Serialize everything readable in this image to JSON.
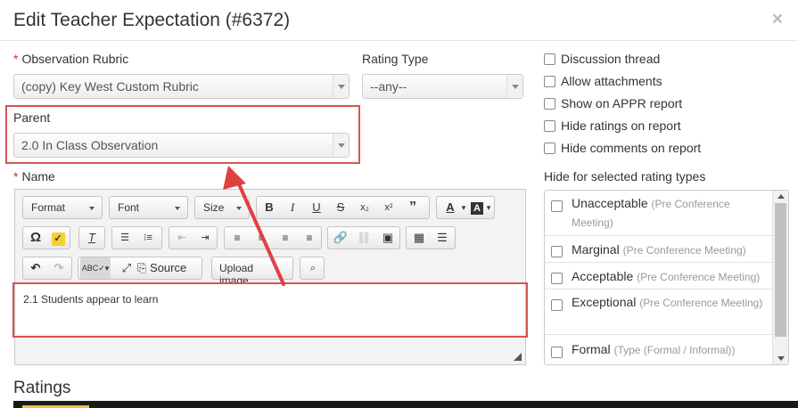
{
  "modal": {
    "title": "Edit Teacher Expectation (#6372)",
    "close_glyph": "×"
  },
  "form": {
    "required_marker": "*",
    "observation_rubric": {
      "label": "Observation Rubric",
      "value": "(copy) Key West Custom Rubric"
    },
    "rating_type": {
      "label": "Rating Type",
      "value": "--any--"
    },
    "parent": {
      "label": "Parent",
      "value": "2.0 In Class Observation"
    },
    "name": {
      "label": "Name"
    }
  },
  "editor": {
    "format_label": "Format",
    "font_label": "Font",
    "size_label": "Size",
    "source_label": "Source",
    "upload_image_label": "Upload image",
    "content": "2.1 Students appear to learn"
  },
  "options": [
    {
      "label": "Discussion thread"
    },
    {
      "label": "Allow attachments"
    },
    {
      "label": "Show on APPR report"
    },
    {
      "label": "Hide ratings on report"
    },
    {
      "label": "Hide comments on report"
    }
  ],
  "hide_rating_types": {
    "label": "Hide for selected rating types",
    "items": [
      {
        "name": "Unacceptable",
        "type": "(Pre Conference Meeting)"
      },
      {
        "name": "Marginal",
        "type": "(Pre Conference Meeting)"
      },
      {
        "name": "Acceptable",
        "type": "(Pre Conference Meeting)"
      },
      {
        "name": "Exceptional",
        "type": "(Pre Conference Meeting)"
      },
      {
        "name": "Formal",
        "type": "(Type (Formal / Informal))"
      }
    ]
  },
  "ratings_section": {
    "title": "Ratings"
  },
  "colors": {
    "annotation_red": "#d9534f",
    "required_red": "#c9302c"
  }
}
